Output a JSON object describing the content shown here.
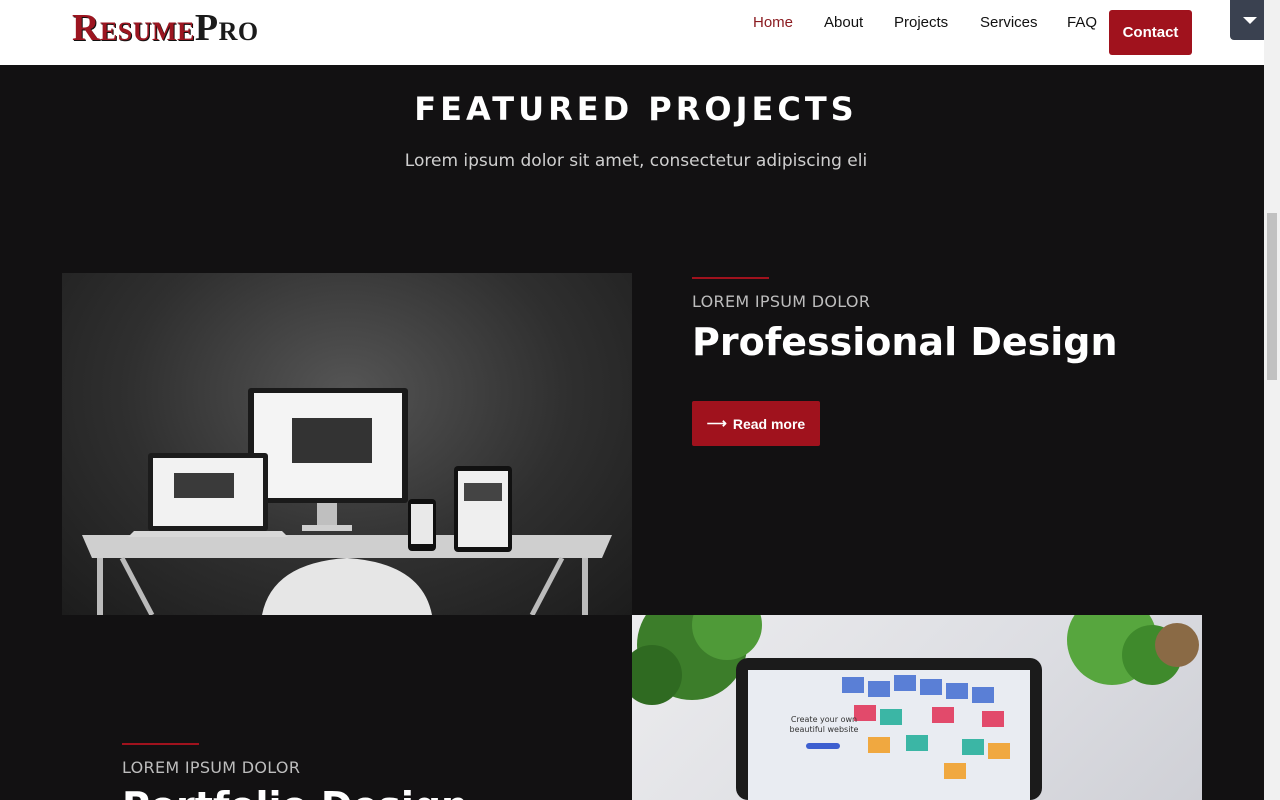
{
  "header": {
    "logo": {
      "part1_big": "R",
      "part1_small": "ESUME",
      "part2_big": "P",
      "part2_small": "RO"
    },
    "nav": [
      {
        "label": "Home",
        "active": true
      },
      {
        "label": "About"
      },
      {
        "label": "Projects"
      },
      {
        "label": "Services"
      },
      {
        "label": "FAQ"
      }
    ],
    "contact_label": "Contact"
  },
  "section": {
    "title": "FEATURED PROJECTS",
    "subtitle": "Lorem ipsum dolor sit amet, consectetur adipiscing eli"
  },
  "projects": [
    {
      "eyebrow": "LOREM IPSUM DOLOR",
      "title": "Professional Design",
      "button_label": "Read more",
      "image_icon": "responsive-devices-photo"
    },
    {
      "eyebrow": "LOREM IPSUM DOLOR",
      "title": "Portfolio Design",
      "image_icon": "laptop-website-photo",
      "image_text_line1": "Create your own",
      "image_text_line2": "beautiful website"
    }
  ],
  "colors": {
    "accent": "#a0121d",
    "background": "#121112",
    "header": "#ffffff"
  }
}
